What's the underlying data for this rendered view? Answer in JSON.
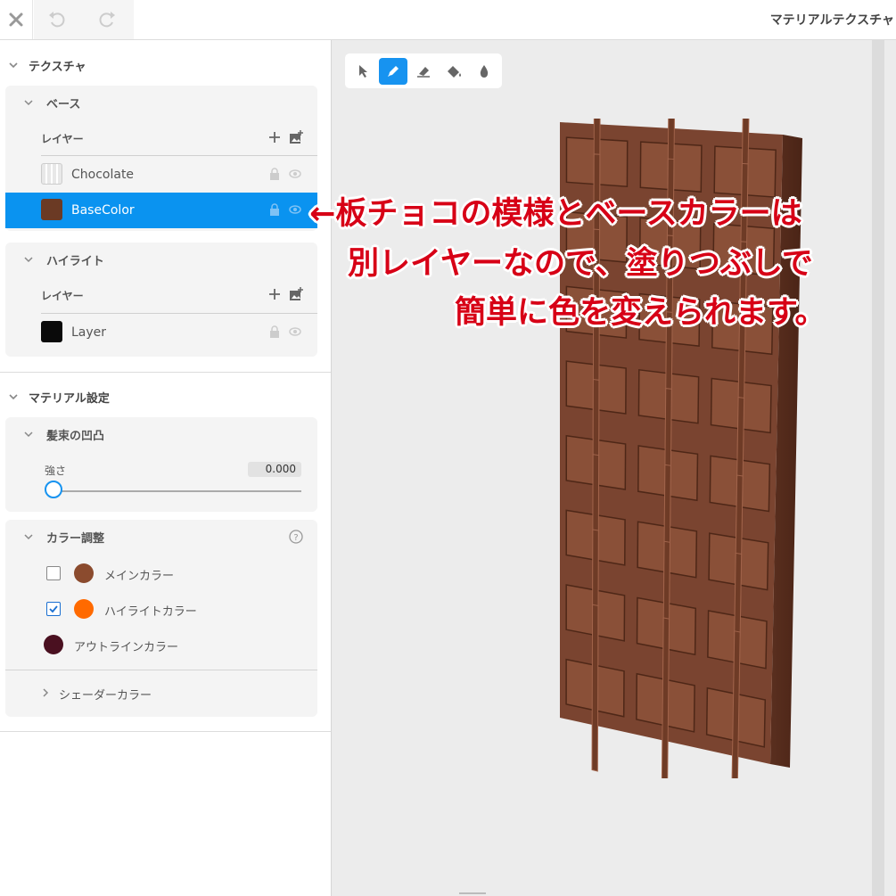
{
  "header": {
    "title": "マテリアルテクスチャ"
  },
  "texture_section": {
    "label": "テクスチャ",
    "base": {
      "label": "ベース",
      "layer_label": "レイヤー",
      "layers": [
        {
          "name": "Chocolate"
        },
        {
          "name": "BaseColor",
          "color": "#6b3a24"
        }
      ]
    },
    "highlight": {
      "label": "ハイライト",
      "layer_label": "レイヤー",
      "layers": [
        {
          "name": "Layer",
          "color": "#0a0a0a"
        }
      ]
    }
  },
  "material_section": {
    "label": "マテリアル設定",
    "bump": {
      "label": "髪束の凹凸",
      "strength_label": "強さ",
      "strength_value": "0.000"
    },
    "color_adjust": {
      "label": "カラー調整",
      "items": [
        {
          "label": "メインカラー",
          "color": "#8b4b2e",
          "checked": false
        },
        {
          "label": "ハイライトカラー",
          "color": "#ff6a00",
          "checked": true
        },
        {
          "label": "アウトラインカラー",
          "color": "#4a1020"
        }
      ],
      "shader_label": "シェーダーカラー"
    }
  },
  "toolbar": {
    "tools": [
      "select-tool",
      "pen-tool",
      "eraser-tool",
      "fill-tool",
      "dropper-tool"
    ],
    "active": "pen-tool"
  },
  "annotation": {
    "line1": "←板チョコの模様とベースカラーは",
    "line2": "別レイヤーなので、塗りつぶしで",
    "line3": "簡単に色を変えられます。"
  },
  "colors": {
    "accent": "#0a93f0",
    "chocolate": "#7a4430",
    "annotation": "#d70016"
  }
}
